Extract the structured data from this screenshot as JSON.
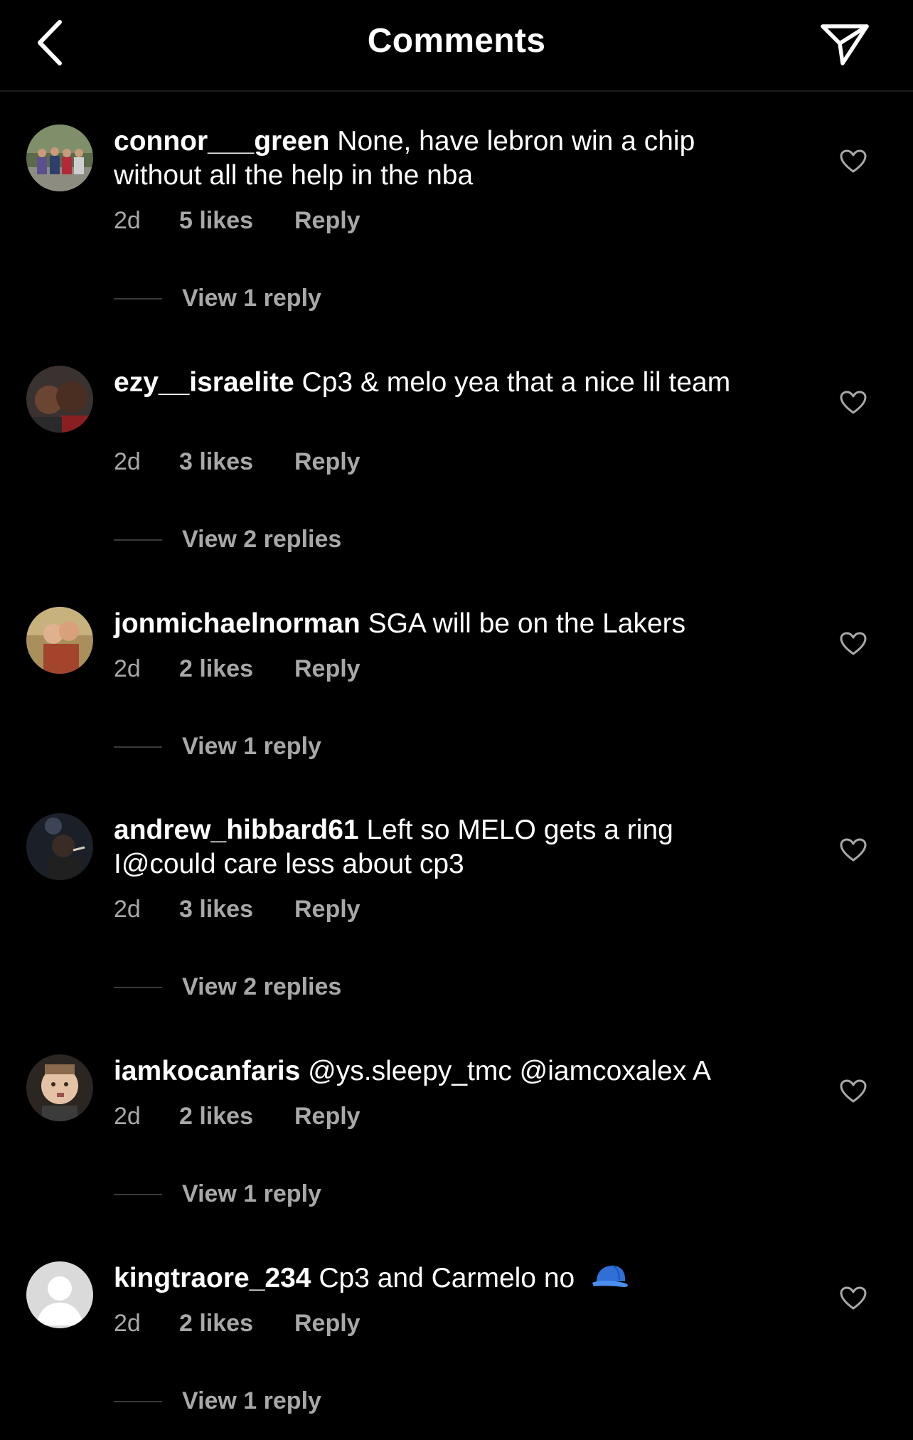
{
  "header": {
    "title": "Comments",
    "back_icon": "chevron-left-icon",
    "send_icon": "paper-plane-icon"
  },
  "colors": {
    "background": "#000000",
    "text": "#ffffff",
    "secondary": "#a8a8a8"
  },
  "comments": [
    {
      "username": "connor___green",
      "text": "None, have lebron win a chip without all the help in the nba",
      "time": "2d",
      "likes": "5 likes",
      "reply": "Reply",
      "view_replies": "View 1 reply"
    },
    {
      "username": "ezy__israelite",
      "text": "Cp3 & melo yea that a nice lil team",
      "time": "2d",
      "likes": "3 likes",
      "reply": "Reply",
      "view_replies": "View 2 replies"
    },
    {
      "username": "jonmichaelnorman",
      "text": "SGA will be on the Lakers",
      "time": "2d",
      "likes": "2 likes",
      "reply": "Reply",
      "view_replies": "View 1 reply"
    },
    {
      "username": "andrew_hibbard61",
      "text": "Left so MELO gets a ring I@could care less about cp3",
      "time": "2d",
      "likes": "3 likes",
      "reply": "Reply",
      "view_replies": "View 2 replies"
    },
    {
      "username": "iamkocanfaris",
      "text": "@ys.sleepy_tmc @iamcoxalex A",
      "time": "2d",
      "likes": "2 likes",
      "reply": "Reply",
      "view_replies": "View 1 reply"
    },
    {
      "username": "kingtraore_234",
      "text": "Cp3 and Carmelo no",
      "emoji": "blue-cap-emoji",
      "time": "2d",
      "likes": "2 likes",
      "reply": "Reply",
      "view_replies": "View 1 reply"
    }
  ]
}
